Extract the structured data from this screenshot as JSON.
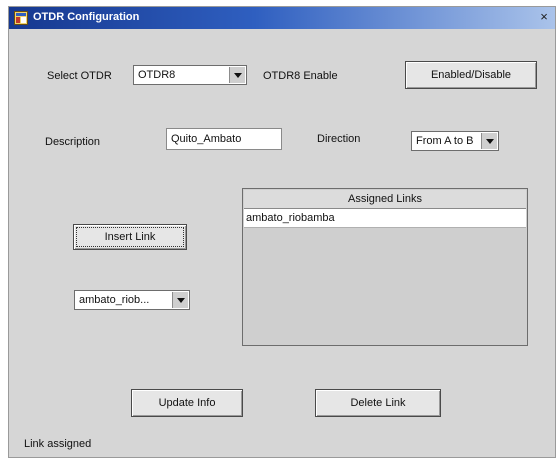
{
  "window": {
    "title": "OTDR Configuration",
    "close_glyph": "×"
  },
  "otdr": {
    "select_label": "Select OTDR",
    "selected_value": "OTDR8",
    "enable_label": "OTDR8 Enable",
    "enable_button": "Enabled/Disable"
  },
  "description": {
    "label": "Description",
    "value": "Quito_Ambato"
  },
  "direction": {
    "label": "Direction",
    "selected_value": "From A to B"
  },
  "links": {
    "insert_button": "Insert Link",
    "selector_value": "ambato_riob...",
    "header": "Assigned Links",
    "rows": [
      "ambato_riobamba"
    ]
  },
  "actions": {
    "update_button": "Update Info",
    "delete_button": "Delete Link"
  },
  "status": {
    "text": "Link assigned"
  },
  "icons": {
    "app": "app-window-icon",
    "close": "close-icon",
    "dropdown": "chevron-down-icon"
  },
  "colors": {
    "title_start": "#16388f",
    "title_end": "#aac3ea",
    "panel": "#d6d6d6"
  }
}
